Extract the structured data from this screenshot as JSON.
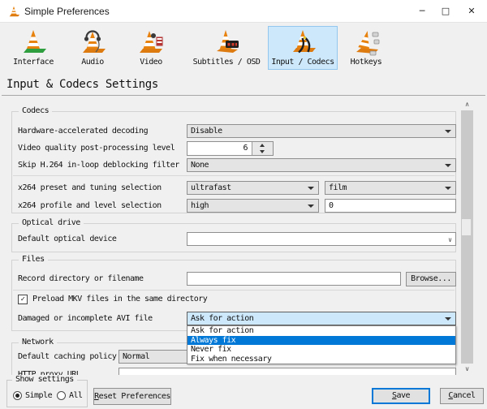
{
  "window": {
    "title": "Simple Preferences",
    "controls": {
      "minimize": "─",
      "maximize": "□",
      "close": "✕"
    }
  },
  "toolbar": {
    "items": [
      {
        "label": "Interface"
      },
      {
        "label": "Audio"
      },
      {
        "label": "Video"
      },
      {
        "label": "Subtitles / OSD"
      },
      {
        "label": "Input / Codecs",
        "selected": true
      },
      {
        "label": "Hotkeys"
      }
    ]
  },
  "page": {
    "heading": "Input & Codecs Settings"
  },
  "codecs": {
    "legend": "Codecs",
    "hw_label": "Hardware-accelerated decoding",
    "hw_value": "Disable",
    "quality_label": "Video quality post-processing level",
    "quality_value": "6",
    "deblock_label": "Skip H.264 in-loop deblocking filter",
    "deblock_value": "None",
    "preset_label": "x264 preset and tuning selection",
    "preset_value": "ultrafast",
    "tuning_value": "film",
    "profile_label": "x264 profile and level selection",
    "profile_value": "high",
    "level_value": "0"
  },
  "optical": {
    "legend": "Optical drive",
    "device_label": "Default optical device",
    "device_value": ""
  },
  "files": {
    "legend": "Files",
    "record_label": "Record directory or filename",
    "record_value": "",
    "browse_label": "Browse...",
    "preload_label": "Preload MKV files in the same directory",
    "preload_checked": true,
    "avi_label": "Damaged or incomplete AVI file",
    "avi_value": "Ask for action"
  },
  "avi_dropdown": {
    "options": [
      "Ask for action",
      "Always fix",
      "Never fix",
      "Fix when necessary"
    ],
    "highlighted": "Always fix"
  },
  "network": {
    "legend": "Network",
    "caching_label": "Default caching policy",
    "caching_value": "Normal",
    "proxy_label": "HTTP proxy URL",
    "proxy_value": ""
  },
  "footer": {
    "show_settings_legend": "Show settings",
    "simple_label": "Simple",
    "all_label": "All",
    "simple_selected": true,
    "reset_label": "Reset Preferences",
    "save_label": "Save",
    "cancel_label": "Cancel"
  },
  "icons": {
    "scroll_up": "∧",
    "scroll_down": "∨",
    "check": "✓",
    "combo_chevron": "∨"
  },
  "colors": {
    "accent": "#0078d7",
    "selected_item_bg": "#cde8fb",
    "focused_combo_bg": "#cde8fb"
  }
}
